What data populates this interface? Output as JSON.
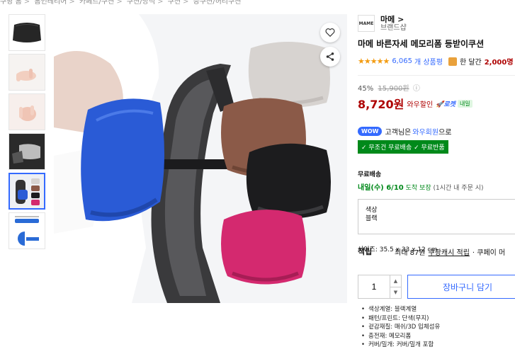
{
  "breadcrumbs": [
    "쿠팡 홈",
    "홈인테리어",
    "카페트/쿠션",
    "쿠션/방석",
    "쿠션",
    "등쿠션/허리쿠션"
  ],
  "gallery": {
    "thumbnails": [
      "검정 쿠션",
      "메모리폼 손",
      "메모리폼 손 2",
      "그레이 쿠션",
      "의자 착용 컬러",
      "사이즈 도면"
    ],
    "active_index": 4
  },
  "brand": {
    "logo_text": "MAME",
    "name": "마메 >",
    "shop": "브랜드샵"
  },
  "product": {
    "title": "마메 바른자세 메모리폼 등받이쿠션",
    "stars": "★★★★★",
    "review_count": "6,065",
    "review_unit": "개 상품평",
    "monthly": "한 달간",
    "monthly_count": "2,000명"
  },
  "price": {
    "discount": "45%",
    "original": "15,900원",
    "info_icon": "ⓘ",
    "sale": "8,720원",
    "wow_label": "와우할인",
    "rocket_label": "🚀로켓",
    "rocket_tag": "내일"
  },
  "wow": {
    "badge": "WOW",
    "text_prefix": "고객님은",
    "link": "와우회원",
    "text_suffix": "으로",
    "benefits": "✓ 무조건 무료배송 ✓ 무료반품"
  },
  "shipping": {
    "label": "무료배송",
    "date": "내일(수) 6/10",
    "arrival": "도착 보장",
    "note": "(1시간 내 주문 시)"
  },
  "option": {
    "label": "색상",
    "value": "블랙"
  },
  "size": "사이즈: 35.5 x 33 x 12 cm",
  "points": {
    "label": "적립",
    "max": "최대 87원",
    "link": "쿠팡캐시 적립",
    "rest": "· 쿠페이 머"
  },
  "quantity": "1",
  "cart_button": "장바구니 담기",
  "specs": [
    "색상계열: 블랙계열",
    "패턴/프린트: 단색(무지)",
    "겉감재질: 매쉬/3D 입체섬유",
    "충전재: 메모리폼",
    "커버/밀개: 커버/밀개 포함"
  ],
  "colors": {
    "accent": "#346aff",
    "price": "#ae0000",
    "rocket_green": "#00891a",
    "cushion_blue": "#2a5bd6",
    "cushion_gray": "#d7d3d0",
    "cushion_brown": "#8b5a48",
    "cushion_black": "#1c1c1e",
    "cushion_pink": "#d4296f"
  }
}
